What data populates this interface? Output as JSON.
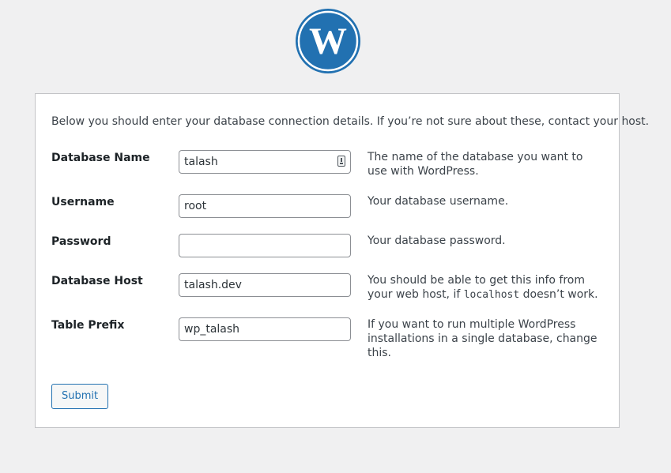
{
  "brand": {
    "logo_icon": "wordpress-logo-icon",
    "logo_color": "#2271b1"
  },
  "intro_text": "Below you should enter your database connection details. If you’re not sure about these, contact your host.",
  "fields": {
    "dbname": {
      "label": "Database Name",
      "value": "talash",
      "description": "The name of the database you want to use with WordPress."
    },
    "username": {
      "label": "Username",
      "value": "root",
      "description": "Your database username."
    },
    "password": {
      "label": "Password",
      "value": "",
      "description": "Your database password."
    },
    "dbhost": {
      "label": "Database Host",
      "value": "talash.dev",
      "description_before": "You should be able to get this info from your web host, if ",
      "description_code": "localhost",
      "description_after": " doesn’t work."
    },
    "prefix": {
      "label": "Table Prefix",
      "value": "wp_talash",
      "description": "If you want to run multiple WordPress installations in a single database, change this."
    }
  },
  "submit_label": "Submit",
  "colors": {
    "background": "#f0f0f1",
    "accent": "#2271b1",
    "card_border": "#c3c4c7"
  }
}
